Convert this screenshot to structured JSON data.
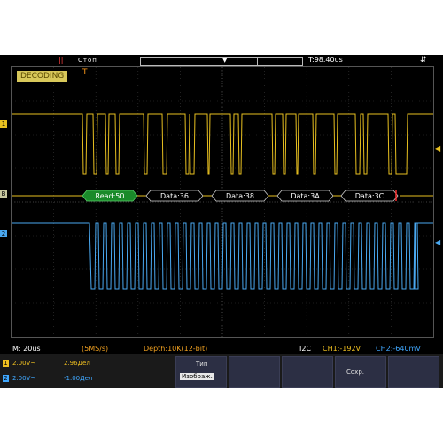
{
  "topbar": {
    "channel_mark": "||",
    "run_state": "Стоп",
    "trigger_pos_tick": "▼",
    "trigger_time": "T:98.40us",
    "usb_icon": "usb-icon"
  },
  "overlay": {
    "mode_badge": "DECODING",
    "trigger_marker": "T"
  },
  "markers": {
    "ch1": "1",
    "bus": "B",
    "ch2": "2"
  },
  "decode": {
    "frames": [
      "Read:50",
      "Data:36",
      "Data:38",
      "Data:3A",
      "Data:3C"
    ]
  },
  "status": {
    "timebase": "M: 20us",
    "sample_rate": "(5MS/s)",
    "depth": "Depth:10K(12-bit)",
    "protocol": "I2C",
    "ch1_level": "CH1:-192V",
    "ch2_level": "CH2:-640mV"
  },
  "channels": [
    {
      "id": "1",
      "scale": "2.00V~",
      "offset": "2.96Дел",
      "color": "#f0c020"
    },
    {
      "id": "2",
      "scale": "2.00V~",
      "offset": "-1.00Дел",
      "color": "#40a8ff"
    }
  ],
  "menu": {
    "type_label": "Тип",
    "type_value": "Изображ.",
    "save_label": "Сохр."
  },
  "colors": {
    "ch1": "#e8c020",
    "ch2": "#4aa8f0",
    "decode_first": "#1a8a2a",
    "grid": "#3a3a3a"
  }
}
